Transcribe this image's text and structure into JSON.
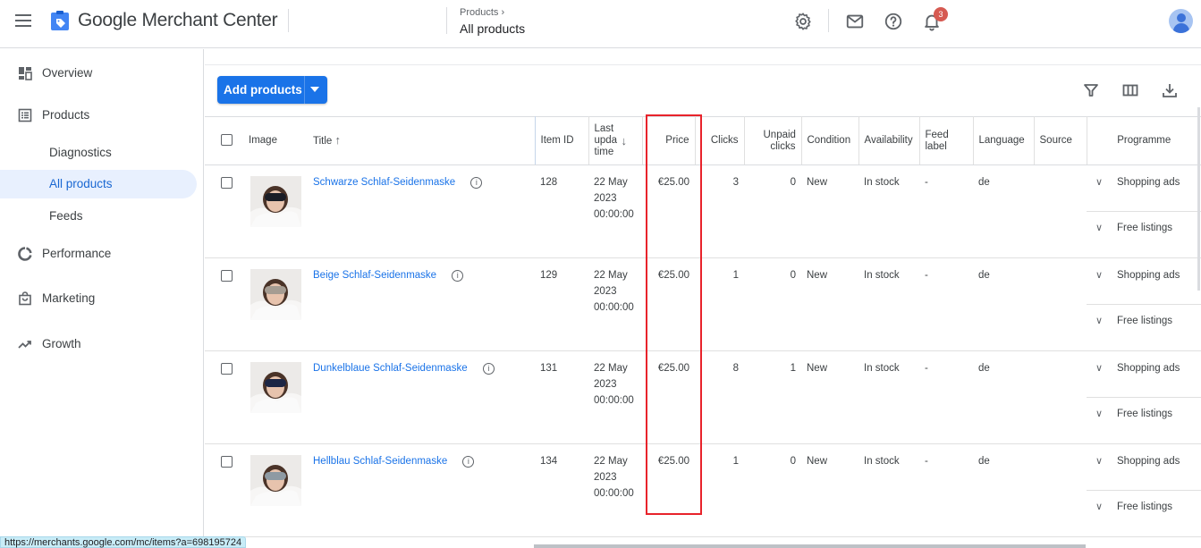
{
  "app": {
    "brand": "Google Merchant Center",
    "icons": {
      "menu": "hamburger-icon",
      "logo": "merchant-tag-logo"
    }
  },
  "header": {
    "breadcrumb_parent": "Products",
    "breadcrumb_current": "All products",
    "icons": [
      "gear-icon",
      "mail-icon",
      "help-icon",
      "bell-icon",
      "avatar"
    ],
    "notification_count": "3"
  },
  "sidebar": {
    "items": [
      {
        "label": "Overview",
        "icon": "dashboard-icon"
      },
      {
        "label": "Products",
        "icon": "list-icon"
      },
      {
        "label": "Diagnostics",
        "sub": true
      },
      {
        "label": "All products",
        "sub": true,
        "active": true
      },
      {
        "label": "Feeds",
        "sub": true
      },
      {
        "label": "Performance",
        "icon": "donut-icon"
      },
      {
        "label": "Marketing",
        "icon": "bag-icon"
      },
      {
        "label": "Growth",
        "icon": "trending-up-icon"
      }
    ]
  },
  "toolbar": {
    "add_products_label": "Add products",
    "icons": [
      "filter-icon",
      "columns-icon",
      "download-icon"
    ]
  },
  "table": {
    "headers": {
      "image": "Image",
      "title": "Title",
      "item_id": "Item ID",
      "last_update": "Last upda time",
      "price": "Price",
      "clicks": "Clicks",
      "unpaid_clicks": "Unpaid clicks",
      "condition": "Condition",
      "availability": "Availability",
      "feed_label": "Feed label",
      "language": "Language",
      "source": "Source",
      "programme": "Programme"
    },
    "rows": [
      {
        "title": "Schwarze Schlaf-Seidenmaske",
        "item_id": "128",
        "date": "22 May",
        "year": "2023",
        "time": "00:00:00",
        "price": "€25.00",
        "clicks": "3",
        "unpaid_clicks": "0",
        "condition": "New",
        "availability": "In stock",
        "feed_label": "-",
        "language": "de",
        "source": "",
        "programmes": [
          "Shopping ads",
          "Free listings"
        ],
        "mask_color": "#1a1d26"
      },
      {
        "title": "Beige Schlaf-Seidenmaske",
        "item_id": "129",
        "date": "22 May",
        "year": "2023",
        "time": "00:00:00",
        "price": "€25.00",
        "clicks": "1",
        "unpaid_clicks": "0",
        "condition": "New",
        "availability": "In stock",
        "feed_label": "-",
        "language": "de",
        "source": "",
        "programmes": [
          "Shopping ads",
          "Free listings"
        ],
        "mask_color": "#a59c92"
      },
      {
        "title": "Dunkelblaue Schlaf-Seidenmaske",
        "item_id": "131",
        "date": "22 May",
        "year": "2023",
        "time": "00:00:00",
        "price": "€25.00",
        "clicks": "8",
        "unpaid_clicks": "1",
        "condition": "New",
        "availability": "In stock",
        "feed_label": "-",
        "language": "de",
        "source": "",
        "programmes": [
          "Shopping ads",
          "Free listings"
        ],
        "mask_color": "#1c2645"
      },
      {
        "title": "Hellblau Schlaf-Seidenmaske",
        "item_id": "134",
        "date": "22 May",
        "year": "2023",
        "time": "00:00:00",
        "price": "€25.00",
        "clicks": "1",
        "unpaid_clicks": "0",
        "condition": "New",
        "availability": "In stock",
        "feed_label": "-",
        "language": "de",
        "source": "",
        "programmes": [
          "Shopping ads",
          "Free listings"
        ],
        "mask_color": "#8e9aa3"
      }
    ]
  },
  "status_bar": {
    "url": "https://merchants.google.com/mc/items?a=698195724"
  },
  "colors": {
    "accent": "#1a73e8",
    "active_nav_bg": "#e8f0fe",
    "highlight": "#e8232b"
  }
}
